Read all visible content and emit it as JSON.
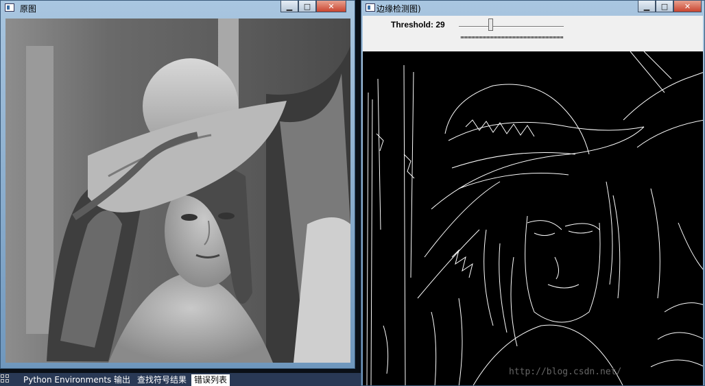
{
  "windows": {
    "original": {
      "title": "原图"
    },
    "edges": {
      "title": "边缘检测图)"
    }
  },
  "caption_buttons": {
    "minimize": "▁",
    "maximize": "□",
    "close": "✕"
  },
  "trackbar": {
    "label": "Threshold: 29",
    "value": 29
  },
  "taskbar": {
    "tabs": [
      "Python Environments",
      "输出",
      "查找符号结果",
      "错误列表"
    ],
    "active_tab": "错误列表"
  },
  "watermark": "http://blog.csdn.net/",
  "icons": [
    "app-icon",
    "minimize-icon",
    "maximize-icon",
    "close-icon",
    "taskbar-grid-icon"
  ],
  "colors": {
    "titlebar": "#8fb2d6",
    "canvas_bg": "#000000",
    "toolbar_bg": "#f0f0f0",
    "taskbar_bg": "#293955"
  }
}
